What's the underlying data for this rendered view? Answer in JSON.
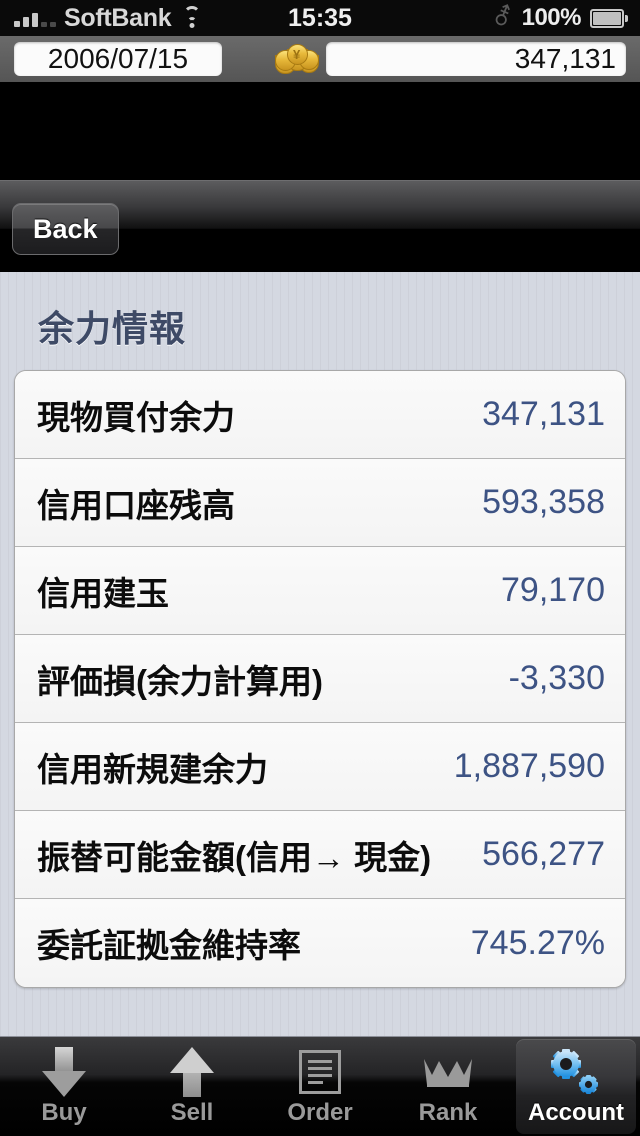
{
  "statusbar": {
    "carrier": "SoftBank",
    "time": "15:35",
    "battery_percent": "100%",
    "signal_icon": "signal-bars-icon",
    "wifi_icon": "wifi-icon",
    "bluetooth_icon": "bluetooth-icon",
    "battery_icon": "battery-icon"
  },
  "infobar": {
    "date": "2006/07/15",
    "coin_icon": "coin-stack-icon",
    "amount": "347,131"
  },
  "navbar": {
    "back_label": "Back"
  },
  "content": {
    "section_title": "余力情報",
    "rows": [
      {
        "label": "現物買付余力",
        "value": "347,131"
      },
      {
        "label": "信用口座残高",
        "value": "593,358"
      },
      {
        "label": "信用建玉",
        "value": "79,170"
      },
      {
        "label": "評価損(余力計算用)",
        "value": "-3,330"
      },
      {
        "label": "信用新規建余力",
        "value": "1,887,590"
      },
      {
        "label": "振替可能金額(信用→ 現金)",
        "value": "566,277"
      },
      {
        "label": "委託証拠金維持率",
        "value": "745.27%"
      }
    ]
  },
  "tabbar": {
    "tabs": [
      {
        "label": "Buy",
        "icon": "arrow-down-icon",
        "selected": false
      },
      {
        "label": "Sell",
        "icon": "arrow-up-icon",
        "selected": false
      },
      {
        "label": "Order",
        "icon": "document-lines-icon",
        "selected": false
      },
      {
        "label": "Rank",
        "icon": "crown-icon",
        "selected": false
      },
      {
        "label": "Account",
        "icon": "gears-icon",
        "selected": true
      }
    ]
  },
  "colors": {
    "value_blue": "#3d5384",
    "title_slate": "#3e4a66",
    "page_bg": "#d4d8e1",
    "accent_gear_blue": "#35a8f0"
  }
}
